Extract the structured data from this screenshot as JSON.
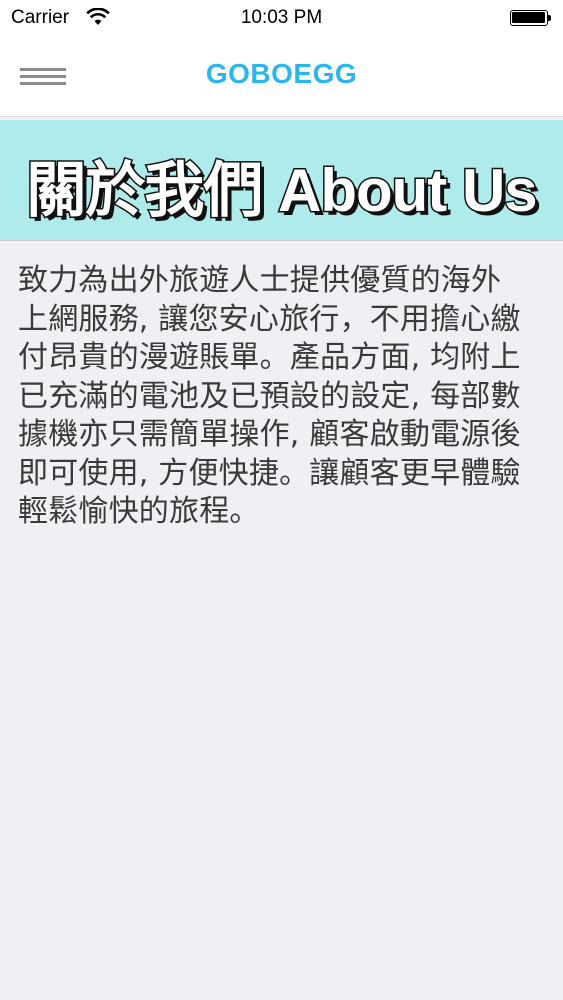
{
  "status_bar": {
    "carrier": "Carrier",
    "time": "10:03 PM",
    "icons": [
      "wifi-icon",
      "battery-icon"
    ]
  },
  "nav_bar": {
    "menu_icon": "hamburger-menu-icon",
    "title": "GOBOEGG",
    "title_color": "#2bb6ee"
  },
  "banner": {
    "title": "關於我們  About Us",
    "background_color": "#b0ebec"
  },
  "content": {
    "lines": [
      "致力為出外旅遊人士提供優質的海外",
      "上網服務, 讓您安心旅行，不用擔心繳",
      "付昂貴的漫遊賬單。產品方面, 均附上",
      "已充滿的電池及已預設的設定, 每部數",
      "據機亦只需簡單操作, 顧客啟動電源後",
      "即可使用, 方便快捷。讓顧客更早體驗",
      "輕鬆愉快的旅程。"
    ]
  }
}
